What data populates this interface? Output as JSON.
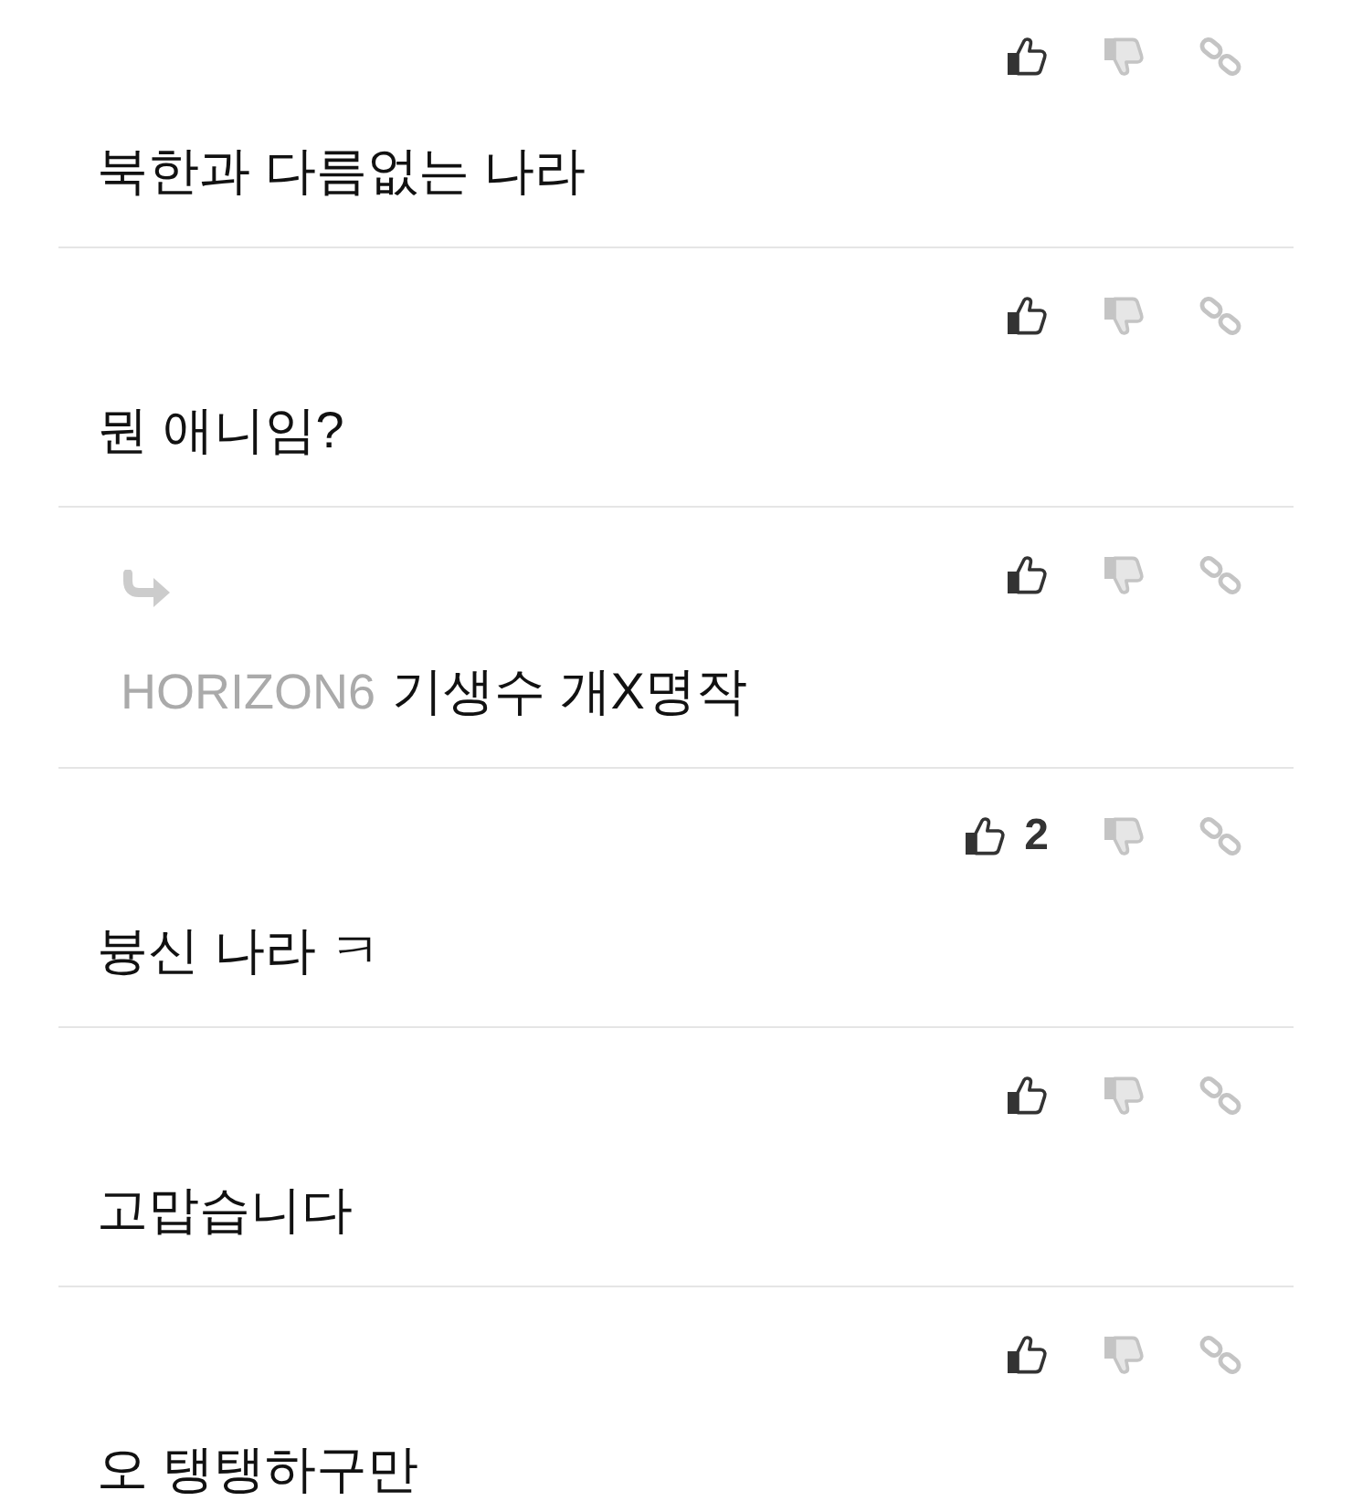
{
  "comments": [
    {
      "kind": "comment",
      "text": "북한과 다름없는 나라"
    },
    {
      "kind": "comment",
      "text": "뭔 애니임?"
    },
    {
      "kind": "reply",
      "author": "HORIZON6",
      "text": "기생수 개X명작"
    },
    {
      "kind": "comment",
      "text": "븅신 나라 ㅋ",
      "likes": "2"
    },
    {
      "kind": "comment",
      "text": "고맙습니다"
    },
    {
      "kind": "comment",
      "text": "오 탱탱하구만"
    }
  ]
}
